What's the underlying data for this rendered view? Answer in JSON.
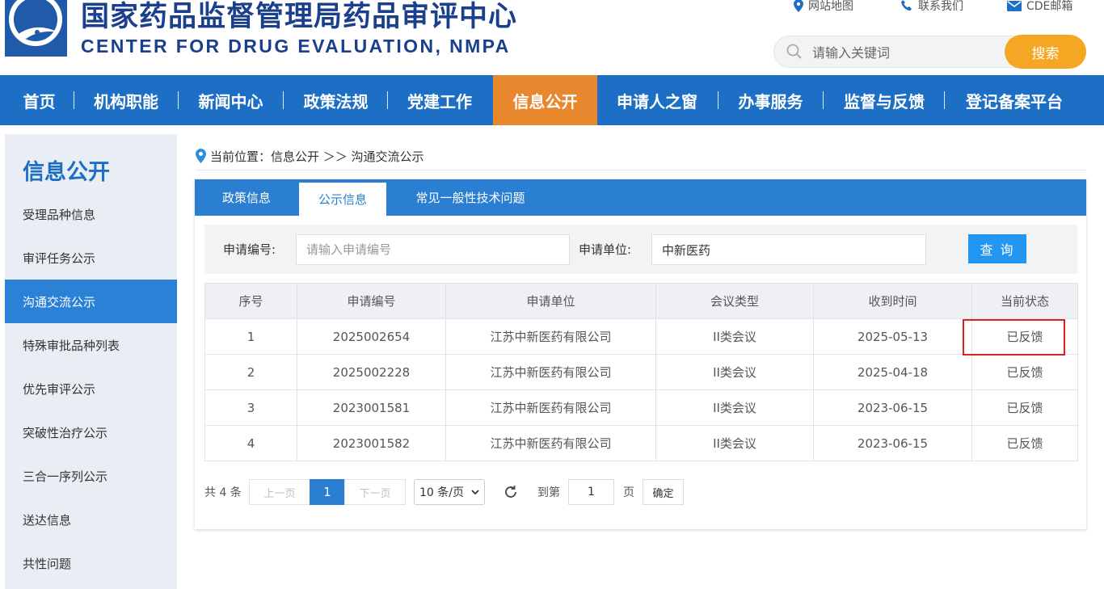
{
  "header": {
    "title_cn": "国家药品监督管理局药品审评中心",
    "title_en": "CENTER FOR DRUG EVALUATION, NMPA",
    "top_links": [
      {
        "label": "网站地图",
        "icon": "map-pin-icon"
      },
      {
        "label": "联系我们",
        "icon": "phone-icon"
      },
      {
        "label": "CDE邮箱",
        "icon": "mail-icon"
      }
    ],
    "search": {
      "placeholder": "请输入关键词",
      "button": "搜索"
    }
  },
  "nav": {
    "items": [
      "首页",
      "机构职能",
      "新闻中心",
      "政策法规",
      "党建工作",
      "信息公开",
      "申请人之窗",
      "办事服务",
      "监督与反馈",
      "登记备案平台"
    ],
    "active": "信息公开"
  },
  "sidebar": {
    "title": "信息公开",
    "items": [
      "受理品种信息",
      "审评任务公示",
      "沟通交流公示",
      "特殊审批品种列表",
      "优先审评公示",
      "突破性治疗公示",
      "三合一序列公示",
      "送达信息",
      "共性问题"
    ],
    "active": "沟通交流公示"
  },
  "breadcrumb": {
    "text": "当前位置：信息公开 ＞＞ 沟通交流公示"
  },
  "tabs": {
    "items": [
      "政策信息",
      "公示信息",
      "常见一般性技术问题"
    ],
    "active": "公示信息"
  },
  "filter": {
    "app_no_label": "申请编号:",
    "app_no_placeholder": "请输入申请编号",
    "app_no_value": "",
    "unit_label": "申请单位:",
    "unit_value": "中新医药",
    "query_button": "查 询"
  },
  "table": {
    "headers": [
      "序号",
      "申请编号",
      "申请单位",
      "会议类型",
      "收到时间",
      "当前状态"
    ],
    "rows": [
      [
        "1",
        "2025002654",
        "江苏中新医药有限公司",
        "II类会议",
        "2025-05-13",
        "已反馈"
      ],
      [
        "2",
        "2025002228",
        "江苏中新医药有限公司",
        "II类会议",
        "2025-04-18",
        "已反馈"
      ],
      [
        "3",
        "2023001581",
        "江苏中新医药有限公司",
        "II类会议",
        "2023-06-15",
        "已反馈"
      ],
      [
        "4",
        "2023001582",
        "江苏中新医药有限公司",
        "II类会议",
        "2023-06-15",
        "已反馈"
      ]
    ]
  },
  "pagination": {
    "total": "共 4 条",
    "prev": "上一页",
    "current_page": "1",
    "next": "下一页",
    "page_size": "10 条/页",
    "goto_label": "到第",
    "goto_value": "1",
    "page_unit": "页",
    "confirm": "确定"
  },
  "colors": {
    "brand_blue": "#1d6fc5",
    "active_orange": "#e8872d",
    "search_orange": "#f5a623",
    "highlight_red": "#e02020"
  }
}
